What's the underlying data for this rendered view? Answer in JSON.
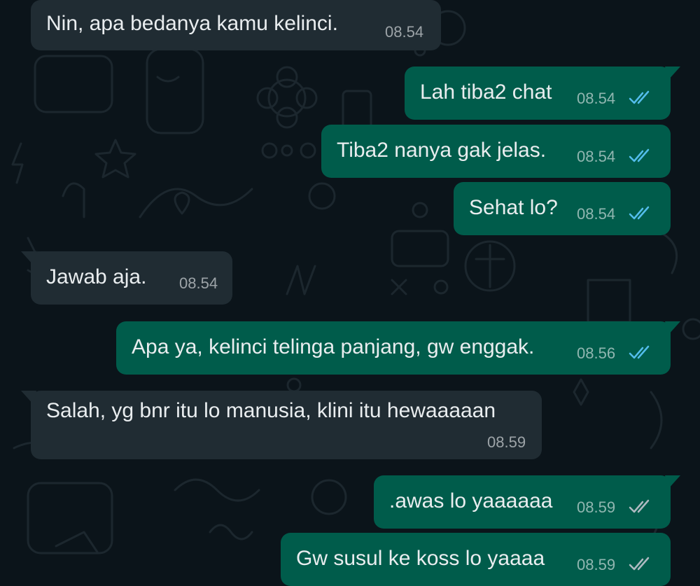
{
  "theme": {
    "background": "#0b141a",
    "incoming_bubble": "#202c33",
    "outgoing_bubble": "#005c4b",
    "text_color": "#e9edef",
    "read_tick_color": "#53bdeb",
    "delivered_tick_color": "#aebac1"
  },
  "messages": [
    {
      "direction": "incoming",
      "text": "Nin, apa bedanya kamu kelinci.",
      "time": "08.54"
    },
    {
      "direction": "outgoing",
      "text": "Lah tiba2 chat",
      "time": "08.54",
      "status": "read",
      "status_icon": "double-check-icon"
    },
    {
      "direction": "outgoing",
      "text": "Tiba2 nanya gak jelas.",
      "time": "08.54",
      "status": "read",
      "status_icon": "double-check-icon"
    },
    {
      "direction": "outgoing",
      "text": "Sehat lo?",
      "time": "08.54",
      "status": "read",
      "status_icon": "double-check-icon"
    },
    {
      "direction": "incoming",
      "text": "Jawab aja.",
      "time": "08.54"
    },
    {
      "direction": "outgoing",
      "text": "Apa ya, kelinci telinga panjang, gw enggak.",
      "time": "08.56",
      "status": "read",
      "status_icon": "double-check-icon"
    },
    {
      "direction": "incoming",
      "text": "Salah, yg bnr itu lo manusia, klini itu hewaaaaan",
      "time": "08.59"
    },
    {
      "direction": "outgoing",
      "text": ".awas lo yaaaaaa",
      "time": "08.59",
      "status": "delivered",
      "status_icon": "double-check-icon"
    },
    {
      "direction": "outgoing",
      "text": "Gw susul ke koss lo yaaaa",
      "time": "08.59",
      "status": "delivered",
      "status_icon": "double-check-icon"
    }
  ]
}
